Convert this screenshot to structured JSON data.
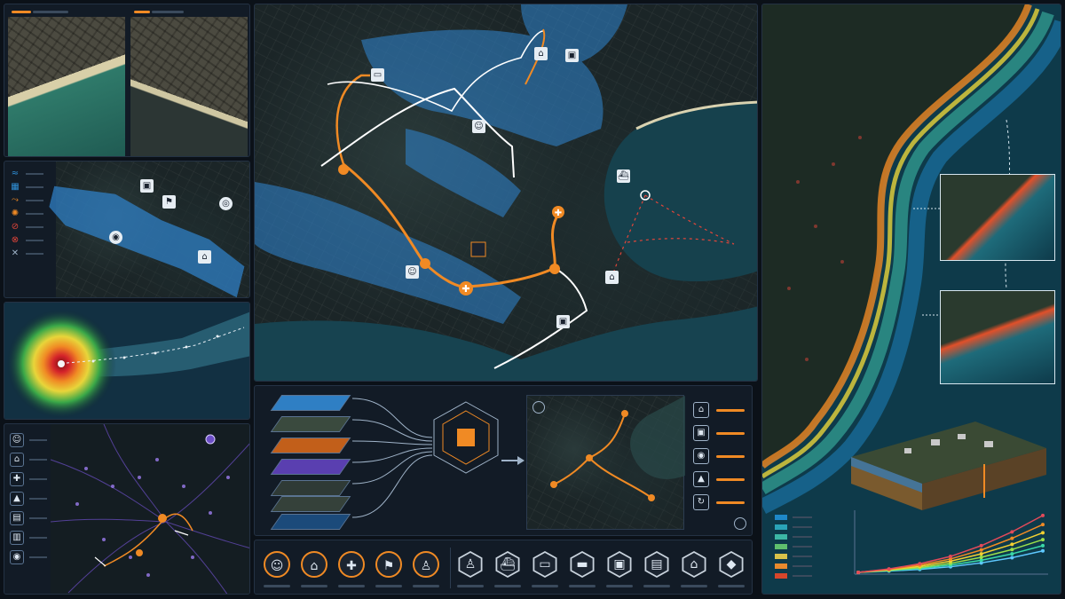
{
  "colors": {
    "accent": "#f08a24",
    "flood": "#2f8fd6",
    "panel_bg": "#121b26",
    "panel_border": "#243244",
    "route": "#ffffff"
  },
  "top_left": {
    "tiles": [
      {
        "name": "coastline-satellite-tile",
        "accent_bar": "orange"
      },
      {
        "name": "shoreline-satellite-tile",
        "accent_bar": "orange"
      }
    ]
  },
  "flood_panel": {
    "legend_icons": [
      "flood-icon",
      "building-icon",
      "route-icon",
      "hazard-icon",
      "blocked-icon",
      "closed-icon",
      "tools-icon"
    ]
  },
  "hurricane_panel": {
    "feature": "hurricane-track"
  },
  "evacuation_panel": {
    "legend_icons": [
      "people-icon",
      "shelter-icon",
      "hospital-icon",
      "school-icon",
      "supply-icon",
      "warehouse-icon",
      "pin-icon"
    ]
  },
  "main_map": {
    "markers": [
      "hospital-marker",
      "shelter-marker",
      "evac-marker"
    ]
  },
  "workflow": {
    "layers": [
      "flood-layer",
      "land-layer",
      "network-layer",
      "population-layer",
      "infrastructure-layer",
      "hurricane-layer"
    ],
    "outputs": [
      "shelter-output",
      "building-output",
      "location-output",
      "supply-output",
      "power-output"
    ]
  },
  "toolbar": {
    "circle_tools": [
      "person-tool",
      "home-tool",
      "medical-tool",
      "rescue-tool",
      "walk-tool"
    ],
    "hex_tools": [
      "hiker-tool",
      "boat-tool",
      "ambulance-tool",
      "fire-truck-tool",
      "car-tool",
      "vehicle-tool",
      "shelter-tool",
      "shield-tool"
    ]
  },
  "coast_panel": {
    "legend_colors": [
      "#1e88c8",
      "#2aa3b8",
      "#3cb7a5",
      "#5fbf6d",
      "#d8c24a",
      "#e88a2e",
      "#d6462b"
    ],
    "chart_data": {
      "type": "line",
      "series": [
        {
          "color": "#5ec8ff",
          "values": [
            0,
            0.3,
            0.7,
            1.3,
            2.2,
            3.4,
            5.0
          ]
        },
        {
          "color": "#3ad9a8",
          "values": [
            0,
            0.4,
            0.9,
            1.7,
            2.8,
            4.3,
            6.2
          ]
        },
        {
          "color": "#9be04b",
          "values": [
            0,
            0.5,
            1.1,
            2.1,
            3.5,
            5.3,
            7.6
          ]
        },
        {
          "color": "#f2d032",
          "values": [
            0,
            0.6,
            1.4,
            2.6,
            4.3,
            6.5,
            9.2
          ]
        },
        {
          "color": "#f08a24",
          "values": [
            0,
            0.7,
            1.7,
            3.1,
            5.2,
            7.9,
            11.1
          ]
        },
        {
          "color": "#e24a5a",
          "values": [
            0,
            0.8,
            2.0,
            3.7,
            6.2,
            9.4,
            13.2
          ]
        }
      ],
      "ylim": [
        0,
        14
      ]
    }
  }
}
